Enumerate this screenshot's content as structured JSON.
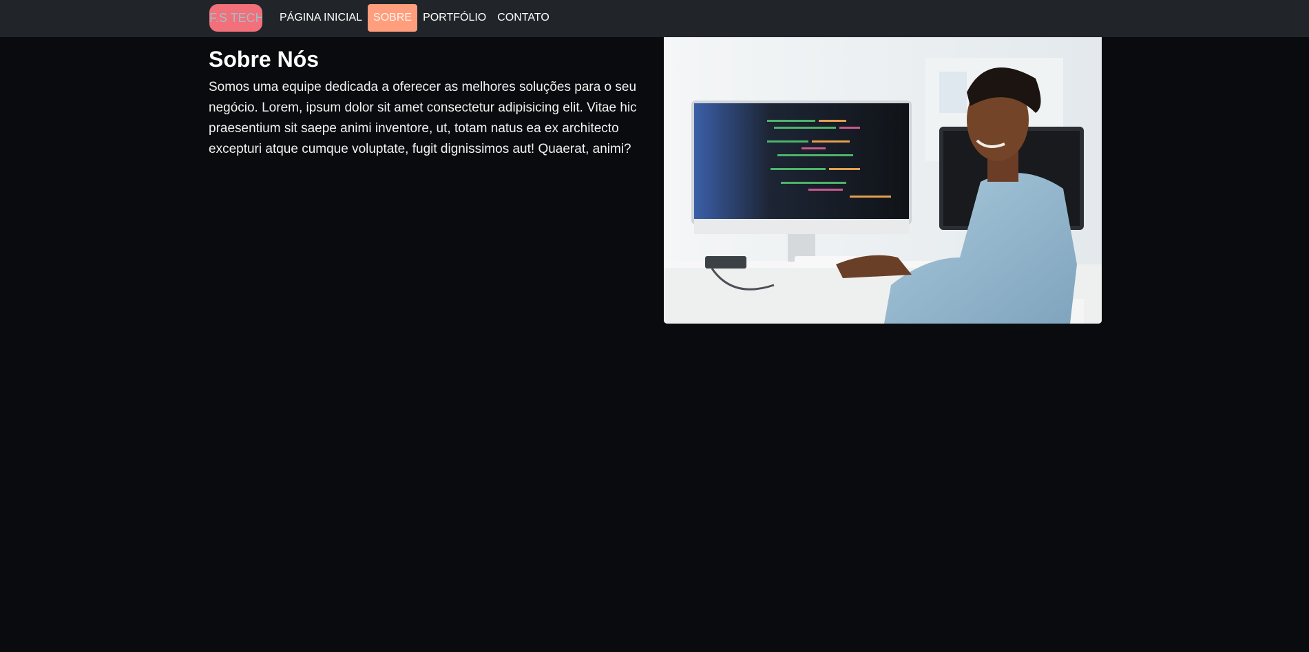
{
  "navbar": {
    "brand": "F.S TECH",
    "links": [
      {
        "label": "PÁGINA INICIAL",
        "active": false
      },
      {
        "label": "SOBRE",
        "active": true
      },
      {
        "label": "PORTFÓLIO",
        "active": false
      },
      {
        "label": "CONTATO",
        "active": false
      }
    ]
  },
  "about": {
    "title": "Sobre Nós",
    "body": "Somos uma equipe dedicada a oferecer as melhores soluções para o seu negócio. Lorem, ipsum dolor sit amet consectetur adipisicing elit. Vitae hic praesentium sit saepe animi inventore, ut, totam natus ea ex architecto excepturi atque cumque voluptate, fugit dignissimos aut! Quaerat, animi?"
  },
  "colors": {
    "page_background": "#0a0b0e",
    "navbar_background": "#212529",
    "brand_background": "#f1707a",
    "active_link_background": "#ff9e7d"
  }
}
